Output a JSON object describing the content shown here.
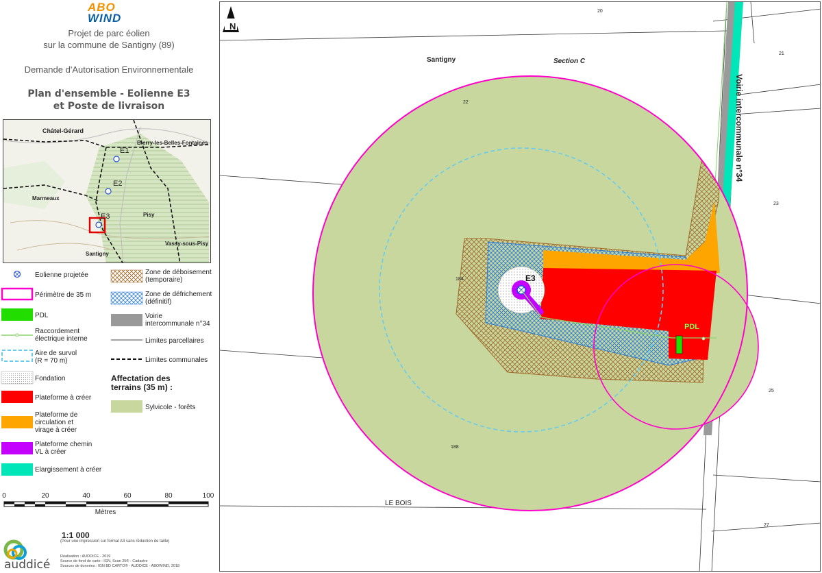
{
  "logo": {
    "line1": "ABO",
    "line2": "WIND"
  },
  "title": {
    "project_line1": "Projet de parc éolien",
    "project_line2": "sur la commune de Santigny (89)",
    "dae": "Demande d'Autorisation Environnementale",
    "plan_line1": "Plan d'ensemble - Eolienne E3",
    "plan_line2": "et Poste de livraison"
  },
  "inset": {
    "places": [
      "Châtel-Gérard",
      "Bierry-les-Belles-Fontaines",
      "Marmeaux",
      "Pisy",
      "Vassy-sous-Pisy",
      "Santigny"
    ],
    "turbines": [
      "E1",
      "E2",
      "E3"
    ]
  },
  "legend": {
    "eolienne": "Eolienne projetée",
    "perimetre": "Périmètre de 35 m",
    "pdl": "PDL",
    "raccordement": [
      "Raccordement",
      "électrique interne"
    ],
    "aire": [
      "Aire de survol",
      "(R = 70 m)"
    ],
    "fondation": "Fondation",
    "plateforme": "Plateforme à créer",
    "circulation": [
      "Plateforme de",
      "circulation et",
      "virage à créer"
    ],
    "chemin": [
      "Plateforme chemin",
      "VL à créer"
    ],
    "elargissement": "Elargissement à créer",
    "deboisement": [
      "Zone de déboisement",
      "(temporaire)"
    ],
    "defrichement": [
      "Zone de défrichement",
      "(définitif)"
    ],
    "voirie": [
      "Voirie",
      "intercommunale n°34"
    ],
    "limites_parc": "Limites parcellaires",
    "limites_comm": "Limites communales",
    "affectation_title": [
      "Affectation des",
      "terrains (35 m) :"
    ],
    "sylvicole": "Sylvicole - forêts"
  },
  "colors": {
    "plateforme": "#ff0000",
    "circulation": "#ffa500",
    "chemin": "#c400ff",
    "elargissement": "#00e6b8",
    "pdl": "#22dd00",
    "perimetre": "#ff00cc",
    "aire": "#66ccee",
    "sylvicole": "#c8d79e",
    "voirie": "#999999",
    "deboisement": "#a0692a",
    "defrichement": "#2b7bd8"
  },
  "scale": {
    "ticks": [
      "0",
      "20",
      "40",
      "60",
      "80",
      "100"
    ],
    "unit": "Mètres",
    "ratio": "1:1 000",
    "ratio_note": "(Pour une impression sur format A3 sans réduction de taille)"
  },
  "credits": [
    "Réalisation : AUDDICE - 2019",
    "Source de fond de carte : IGN, Scan 25® - Cadastre",
    "Sources de données : IGN BD CARTO® - AUDDICE - ABOWIND, 2018"
  ],
  "auddice": "auddicé",
  "map": {
    "north": "N",
    "commune": "Santigny",
    "section": "Section C",
    "lieu_dit": "LE BOIS",
    "route": "Voirie intercommunale n°34",
    "turbine": "E3",
    "pdl": "PDL",
    "parcels": [
      "20",
      "21",
      "22",
      "23",
      "184",
      "25",
      "188",
      "27"
    ]
  }
}
